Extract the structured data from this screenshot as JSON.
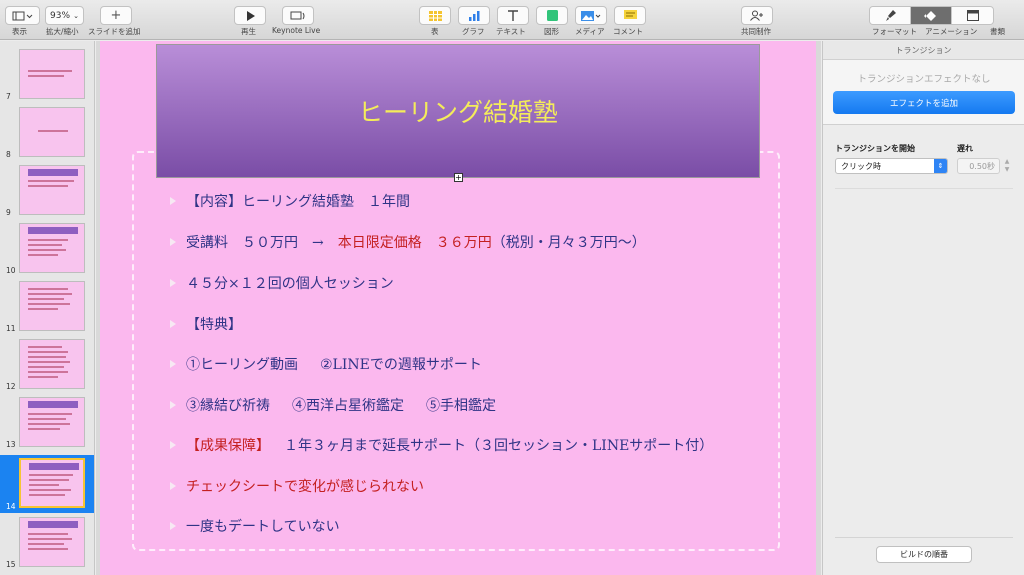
{
  "toolbar": {
    "view_label": "表示",
    "zoom_value": "93%",
    "zoom_label": "拡大/縮小",
    "add_slide_label": "スライドを追加",
    "play_label": "再生",
    "keynote_live_label": "Keynote Live",
    "table_label": "表",
    "chart_label": "グラフ",
    "text_label": "テキスト",
    "shape_label": "図形",
    "media_label": "メディア",
    "comment_label": "コメント",
    "collaborate_label": "共同制作",
    "format_label": "フォーマット",
    "animate_label": "アニメーション",
    "document_label": "書類"
  },
  "navigator": {
    "slides": [
      {
        "num": "7",
        "selected": false
      },
      {
        "num": "8",
        "selected": false
      },
      {
        "num": "9",
        "selected": false
      },
      {
        "num": "10",
        "selected": false
      },
      {
        "num": "11",
        "selected": false
      },
      {
        "num": "12",
        "selected": false
      },
      {
        "num": "13",
        "selected": false
      },
      {
        "num": "14",
        "selected": true
      },
      {
        "num": "15",
        "selected": false
      }
    ]
  },
  "slide": {
    "title": "ヒーリング結婚塾",
    "line1": "【内容】ヒーリング結婚塾　１年間",
    "line2a": "受講料　５０万円　→　",
    "line2b": "本日限定価格　３６万円",
    "line2c": "（税別・月々３万円〜）",
    "line3": "４５分×１２回の個人セッション",
    "line4": "【特典】",
    "line5a": "①ヒーリング動画",
    "line5b": "②LINEでの週報サポート",
    "line6a": "③縁結び祈祷",
    "line6b": "④西洋占星術鑑定",
    "line6c": "⑤手相鑑定",
    "line7a": "【成果保障】",
    "line7b": "　１年３ヶ月まで延長サポート（３回セッション・LINEサポート付）",
    "line8": "チェックシートで変化が感じられない",
    "line9": "一度もデートしていない"
  },
  "inspector": {
    "header": "トランジション",
    "no_effect": "トランジションエフェクトなし",
    "add_effect": "エフェクトを追加",
    "start_label": "トランジションを開始",
    "delay_label": "遅れ",
    "start_value": "クリック時",
    "delay_value": "0.50秒",
    "build_order": "ビルドの順番"
  },
  "colors": {
    "slide_bg": "#fbb8ee",
    "title_text": "#f4ec5a",
    "body_text": "#2f3486",
    "emphasis": "#c42020",
    "accent_blue": "#1479f0"
  }
}
